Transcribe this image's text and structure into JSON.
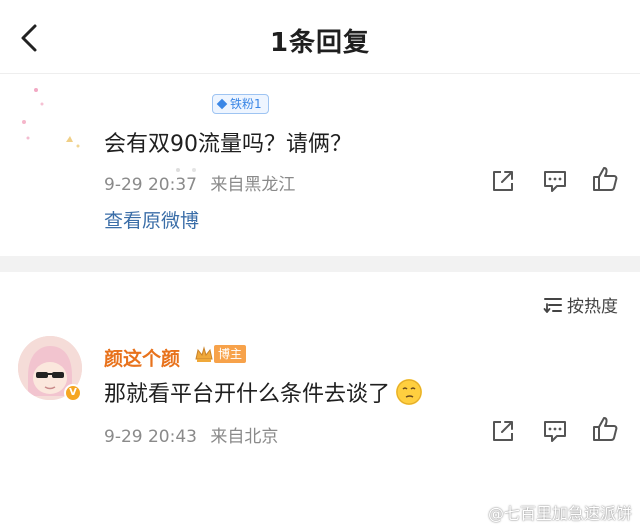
{
  "header": {
    "title": "1条回复"
  },
  "original": {
    "badge_label": "铁粉1",
    "text": "会有双90流量吗？请俩？",
    "date": "9-29 20:37",
    "location": "来自黑龙江",
    "view_original_label": "查看原微博"
  },
  "sort": {
    "label": "按热度"
  },
  "reply": {
    "username": "颜这个颜",
    "poster_badge": "博主",
    "text": "那就看平台开什么条件去谈了",
    "date": "9-29 20:43",
    "location": "来自北京",
    "avatar_badge": "V"
  },
  "watermark": "@七百里加急速派饼",
  "colors": {
    "link": "#3b6ea8",
    "username": "#e8721c",
    "badge_blue": "#3b87e6",
    "badge_orange": "#f7a24a"
  }
}
